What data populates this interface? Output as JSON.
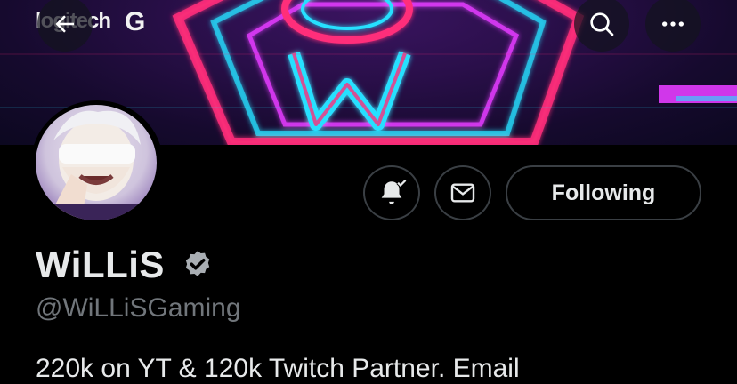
{
  "banner": {
    "brand_text": "logitech",
    "brand_mark": "G",
    "accent_pink": "#ff2d7a",
    "accent_cyan": "#27e0ff",
    "accent_magenta": "#e43cff"
  },
  "nav": {
    "back_icon": "back-arrow-icon",
    "search_icon": "search-icon",
    "more_icon": "more-icon"
  },
  "actions": {
    "notifications_icon": "bell-check-icon",
    "message_icon": "mail-icon",
    "following_label": "Following"
  },
  "profile": {
    "display_name": "WiLLiS",
    "handle": "@WiLLiSGaming",
    "bio_partial": "220k on YT & 120k Twitch Partner. Email",
    "verified_icon": "verified-badge-icon"
  }
}
